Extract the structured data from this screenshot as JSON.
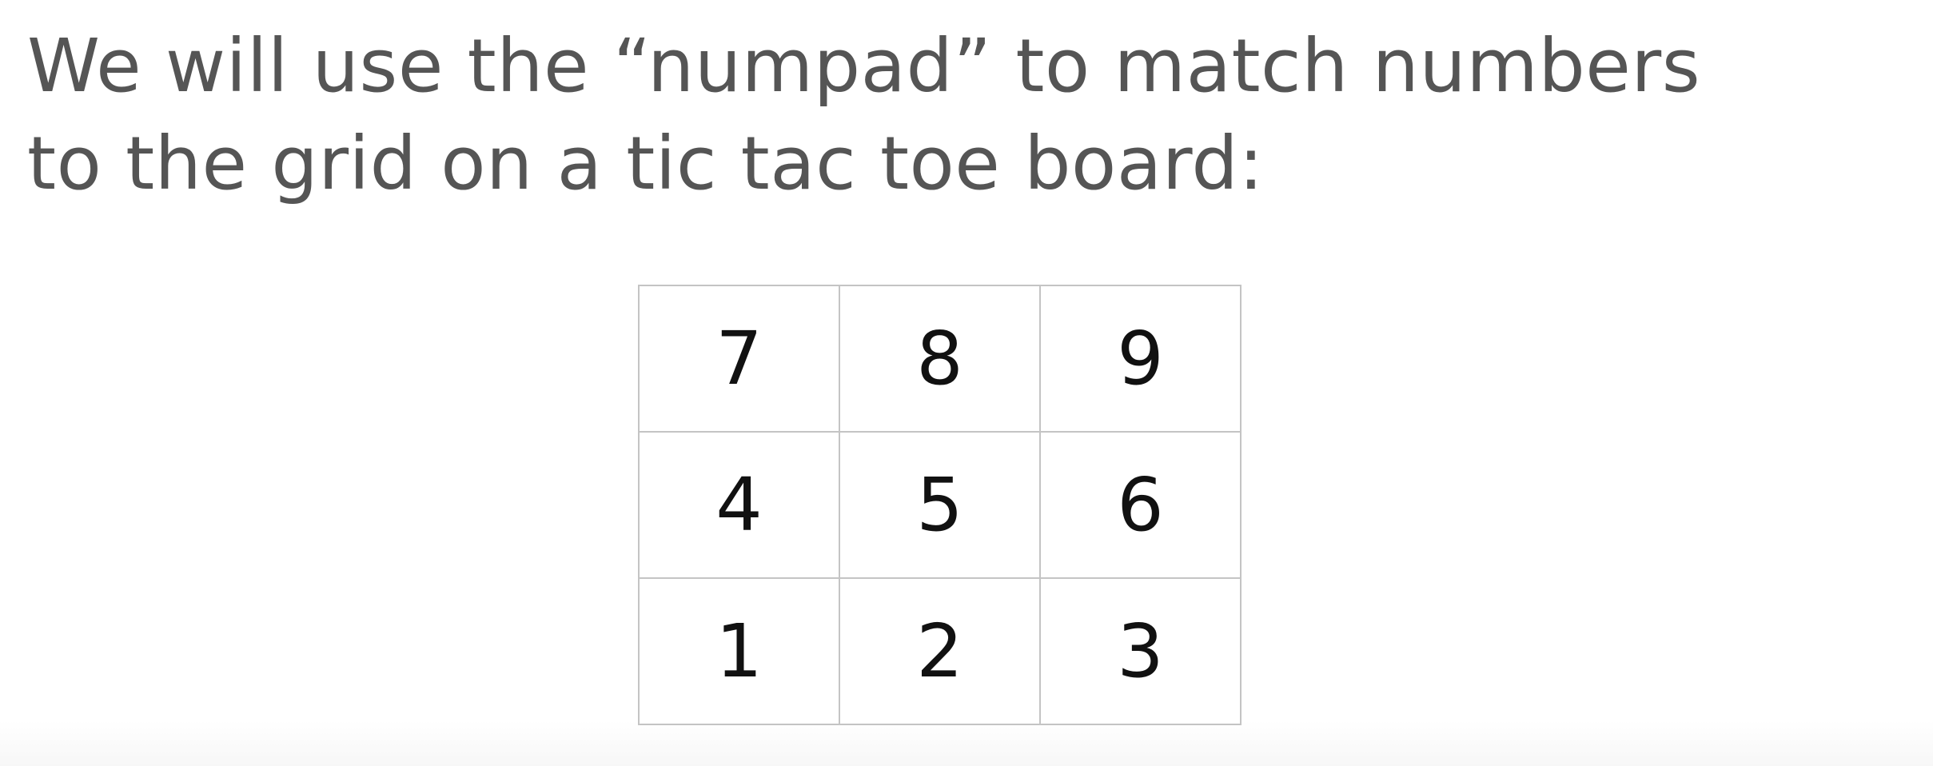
{
  "heading": {
    "line1": "We will use the “numpad” to match numbers",
    "line2": "to the grid on a tic tac toe board:"
  },
  "board": {
    "rows": [
      [
        "7",
        "8",
        "9"
      ],
      [
        "4",
        "5",
        "6"
      ],
      [
        "1",
        "2",
        "3"
      ]
    ]
  }
}
